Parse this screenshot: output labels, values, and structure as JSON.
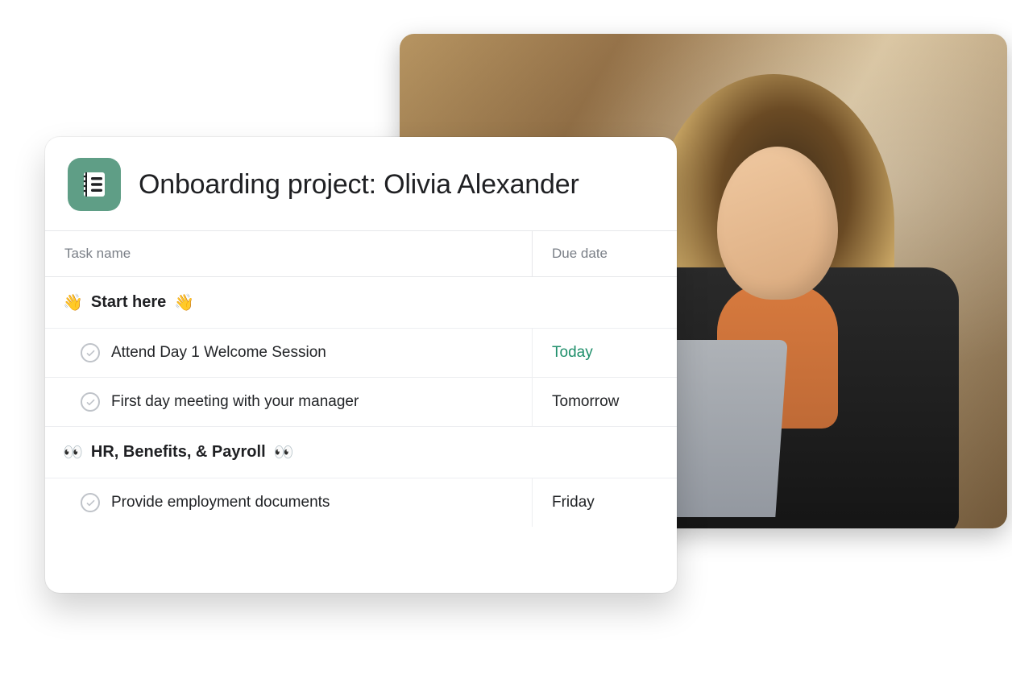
{
  "project": {
    "title": "Onboarding project: Olivia Alexander",
    "iconColor": "#5f9e86"
  },
  "columns": {
    "taskName": "Task name",
    "dueDate": "Due date"
  },
  "sections": [
    {
      "emoji": "👋",
      "title": "Start here",
      "tasks": [
        {
          "name": "Attend Day 1 Welcome Session",
          "due": "Today",
          "dueHighlight": true
        },
        {
          "name": "First day meeting with your manager",
          "due": "Tomorrow",
          "dueHighlight": false
        }
      ]
    },
    {
      "emoji": "👀",
      "title": "HR, Benefits, & Payroll",
      "tasks": [
        {
          "name": "Provide employment documents",
          "due": "Friday",
          "dueHighlight": false
        }
      ]
    }
  ]
}
